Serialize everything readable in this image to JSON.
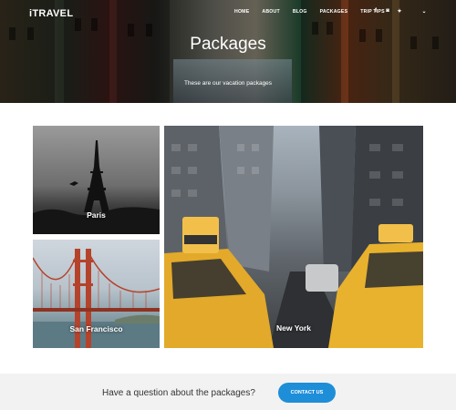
{
  "header": {
    "logo": "iTRAVEL",
    "nav": [
      {
        "label": "HOME"
      },
      {
        "label": "ABOUT"
      },
      {
        "label": "BLOG"
      },
      {
        "label": "PACKAGES"
      },
      {
        "label": "TRIP TIPS"
      }
    ],
    "social": [
      {
        "icon": "facebook-icon",
        "glyph": "f"
      },
      {
        "icon": "instagram-icon",
        "glyph": "◙"
      },
      {
        "icon": "twitter-icon",
        "glyph": "✦"
      },
      {
        "icon": "chevron-down-icon",
        "glyph": "⌄"
      }
    ]
  },
  "hero": {
    "title": "Packages",
    "subtitle": "These are our vacation packages"
  },
  "packages": [
    {
      "name": "Paris"
    },
    {
      "name": "San Francisco"
    },
    {
      "name": "New York"
    }
  ],
  "cta": {
    "text": "Have a question about the packages?",
    "button": "CONTACT US"
  },
  "colors": {
    "accent": "#1e8ed8",
    "cta_background": "#f2f2f2"
  }
}
